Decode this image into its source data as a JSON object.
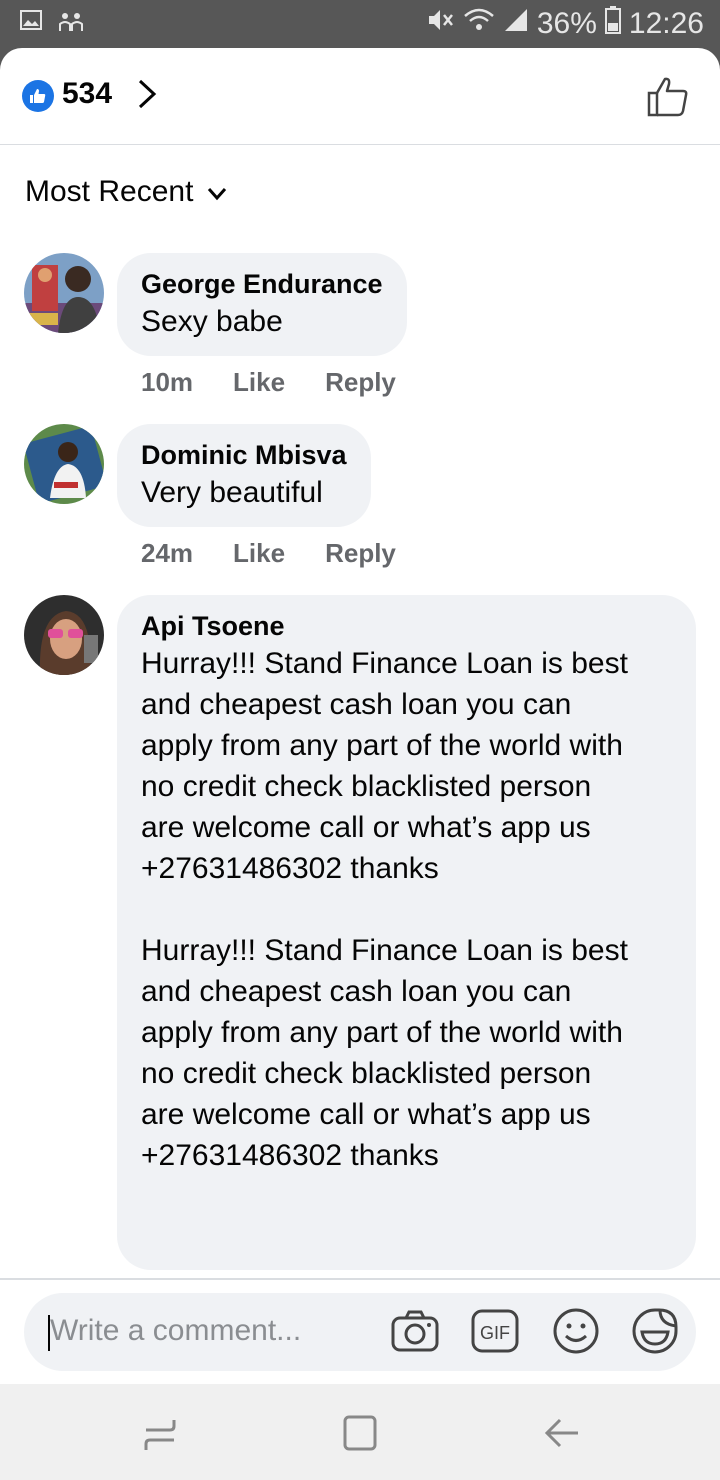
{
  "status_bar": {
    "battery": "36%",
    "time": "12:26",
    "icons": [
      "gallery-icon",
      "people-icon",
      "mute-icon",
      "wifi-icon",
      "signal-icon",
      "battery-icon"
    ]
  },
  "header": {
    "reaction_count": "534",
    "reaction_icon": "like-badge-icon",
    "like_icon": "thumbs-up-icon"
  },
  "sort": {
    "label": "Most Recent"
  },
  "comments": [
    {
      "author": "George Endurance",
      "text": "Sexy babe",
      "time": "10m",
      "like_label": "Like",
      "reply_label": "Reply"
    },
    {
      "author": "Dominic Mbisva",
      "text": "Very beautiful",
      "time": "24m",
      "like_label": "Like",
      "reply_label": "Reply"
    },
    {
      "author": "Api Tsoene",
      "text": "Hurray!!!  Stand Finance Loan is best\nand cheapest cash loan you can\napply from any part of the world with\nno credit check blacklisted person\nare welcome call or what’s app us\n+27631486302  thanks\n\nHurray!!!  Stand Finance Loan is best\nand cheapest cash loan you can\napply from any part of the world with\nno credit check blacklisted person\nare welcome call or what’s app us\n+27631486302  thanks"
    }
  ],
  "composer": {
    "placeholder": "Write a comment...",
    "tools": [
      "camera-icon",
      "gif-icon",
      "emoji-icon",
      "sticker-icon"
    ]
  },
  "colors": {
    "accent": "#1b74e4",
    "bubble": "#f0f2f5",
    "meta_text": "#65676b"
  }
}
